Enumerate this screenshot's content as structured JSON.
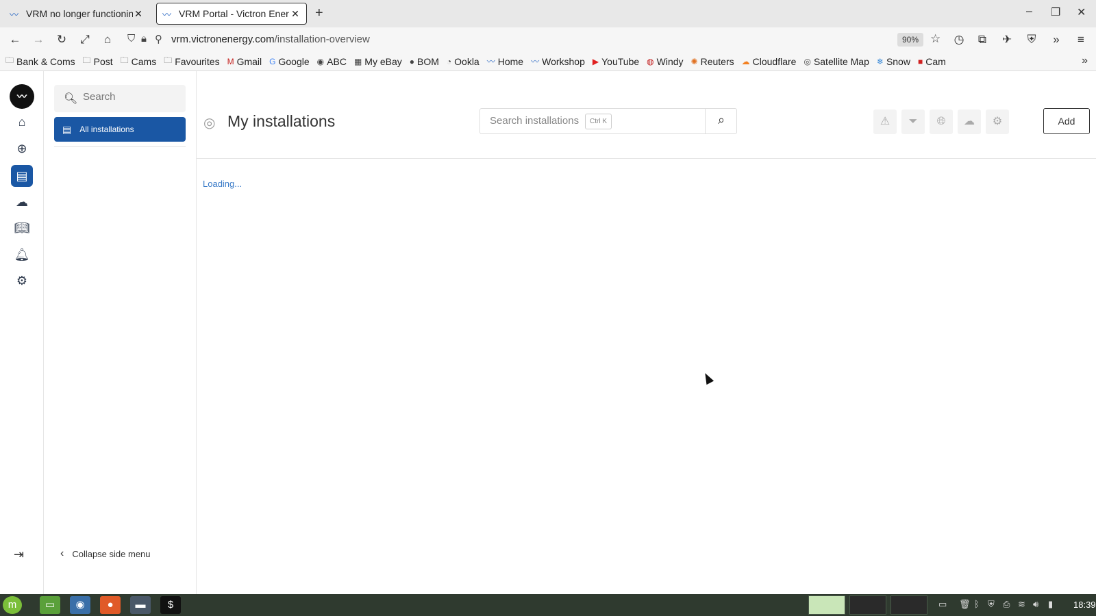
{
  "browser": {
    "tabs": [
      {
        "title": "VRM no longer functionin",
        "active": false
      },
      {
        "title": "VRM Portal - Victron Ener",
        "active": true
      }
    ],
    "url_host": "vrm.victronenergy.com",
    "url_path": "/installation-overview",
    "zoom": "90%",
    "bookmarks": [
      {
        "label": "Bank & Coms",
        "icon": "folder-icon"
      },
      {
        "label": "Post",
        "icon": "folder-icon"
      },
      {
        "label": "Cams",
        "icon": "folder-icon"
      },
      {
        "label": "Favourites",
        "icon": "folder-icon"
      },
      {
        "label": "Gmail",
        "icon": "gmail-icon"
      },
      {
        "label": "Google",
        "icon": "google-icon"
      },
      {
        "label": "ABC",
        "icon": "abc-icon"
      },
      {
        "label": "My eBay",
        "icon": "ebay-icon"
      },
      {
        "label": "BOM",
        "icon": "bom-icon"
      },
      {
        "label": "Ookla",
        "icon": "ookla-icon"
      },
      {
        "label": "Home",
        "icon": "victron-icon"
      },
      {
        "label": "Workshop",
        "icon": "victron-icon"
      },
      {
        "label": "YouTube",
        "icon": "youtube-icon"
      },
      {
        "label": "Windy",
        "icon": "windy-icon"
      },
      {
        "label": "Reuters",
        "icon": "reuters-icon"
      },
      {
        "label": "Cloudflare",
        "icon": "cloudflare-icon"
      },
      {
        "label": "Satellite Map",
        "icon": "satellite-icon"
      },
      {
        "label": "Snow",
        "icon": "snow-icon"
      },
      {
        "label": "Cam",
        "icon": "cam-icon"
      }
    ]
  },
  "sidebar": {
    "search_placeholder": "Search",
    "active_item": "All installations",
    "collapse_label": "Collapse side menu"
  },
  "main": {
    "title": "My installations",
    "search_placeholder": "Search installations",
    "shortcut": "Ctrl K",
    "add_label": "Add",
    "status": "Loading..."
  },
  "taskbar": {
    "clock": "18:39"
  }
}
